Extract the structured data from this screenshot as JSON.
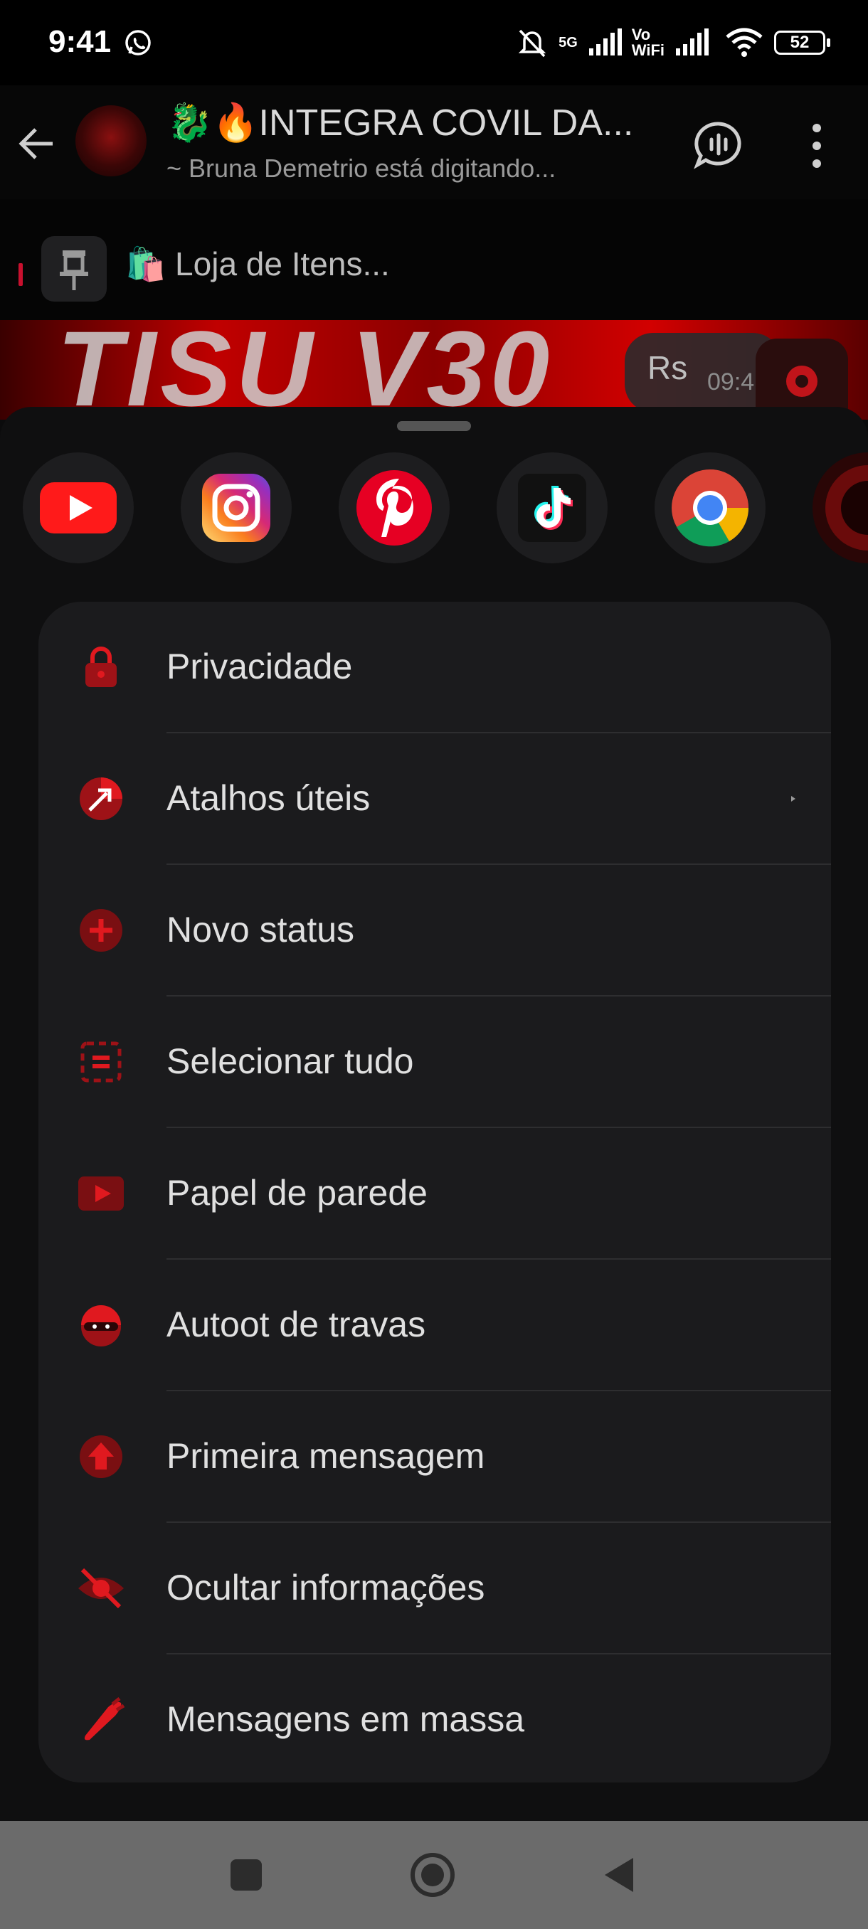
{
  "status_bar": {
    "time": "9:41",
    "network_1": "5G",
    "network_2_top": "Vo",
    "network_2_bottom": "WiFi",
    "battery": "52"
  },
  "header": {
    "title": "🐉🔥INTEGRA COVIL DA...",
    "subtitle": "~ Bruna Demetrio está digitando..."
  },
  "pinned": {
    "text": "🛍️ Loja de Itens..."
  },
  "chat": {
    "banner_text": "TISU V30",
    "bubble_text": "Rs",
    "bubble_time": "09:4"
  },
  "shortcuts": [
    {
      "name": "youtube-icon"
    },
    {
      "name": "instagram-icon"
    },
    {
      "name": "pinterest-icon"
    },
    {
      "name": "tiktok-icon"
    },
    {
      "name": "chrome-icon"
    }
  ],
  "menu": {
    "items": [
      {
        "label": "Privacidade",
        "icon": "lock-icon"
      },
      {
        "label": "Atalhos úteis",
        "icon": "shortcut-icon",
        "has_arrow": true
      },
      {
        "label": "Novo status",
        "icon": "plus-circle-icon"
      },
      {
        "label": "Selecionar tudo",
        "icon": "select-all-icon"
      },
      {
        "label": "Papel de parede",
        "icon": "wallpaper-icon"
      },
      {
        "label": "Autoot de travas",
        "icon": "ninja-icon"
      },
      {
        "label": "Primeira mensagem",
        "icon": "arrow-up-circle-icon"
      },
      {
        "label": "Ocultar informações",
        "icon": "eye-off-icon"
      },
      {
        "label": "Mensagens em massa",
        "icon": "rocket-icon"
      }
    ]
  },
  "colors": {
    "accent": "#e0191f",
    "accent_dark": "#7a0f12",
    "card": "#1b1b1d"
  }
}
